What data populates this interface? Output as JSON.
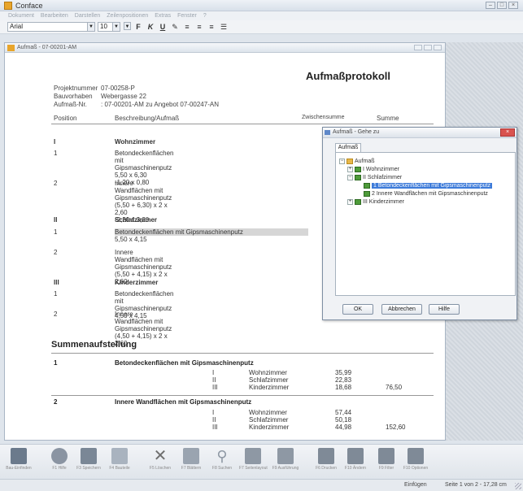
{
  "app": {
    "title": "Conface",
    "menu": [
      "Dokument",
      "Bearbeiten",
      "Darstellen",
      "Zeilenpositionen",
      "Extras",
      "Fenster",
      "?"
    ]
  },
  "format": {
    "font": "Arial",
    "size": "10"
  },
  "docwin": {
    "title": "Aufmaß - 07-00201-AM"
  },
  "doc": {
    "title": "Aufmaßprotokoll",
    "meta": [
      {
        "label": "Projektnummer",
        "value": "07-00258-P"
      },
      {
        "label": "Bauvorhaben",
        "value": "Webergasse 22"
      },
      {
        "label": "Aufmaß-Nr.",
        "value": ": 07-00201-AM zu Angebot 07-00247-AN"
      }
    ],
    "columns": {
      "position": "Position",
      "description": "Beschreibung/Aufmaß",
      "subtotal": "Zwischensumme",
      "total": "Summe"
    },
    "sections": [
      {
        "num": "I",
        "title": "Wohnzimmer",
        "items": [
          {
            "num": "1",
            "lines": [
              "Betondeckenflächen mit Gipsmaschinenputz",
              "5,50 x 6,30",
              "-1,20 x 0,80"
            ]
          },
          {
            "num": "2",
            "lines": [
              "Innere Wandflächen mit Gipsmaschinenputz",
              "(5,50 + 6,30) x 2 x 2,60",
              "-2,20 x 3,20"
            ]
          }
        ]
      },
      {
        "num": "II",
        "title": "Schlafzimmer",
        "items": [
          {
            "num": "1",
            "lines": [
              "Betondeckenflächen mit Gipsmaschinenputz",
              "5,50 x 4,15"
            ]
          },
          {
            "num": "2",
            "lines": [
              "Innere Wandflächen mit Gipsmaschinenputz",
              "(5,50 + 4,15) x 2 x 2,60"
            ]
          }
        ]
      },
      {
        "num": "III",
        "title": "Kinderzimmer",
        "items": [
          {
            "num": "1",
            "lines": [
              "Betondeckenflächen mit Gipsmaschinenputz",
              "4,50 x 4,15"
            ]
          },
          {
            "num": "2",
            "lines": [
              "Innere Wandflächen mit Gipsmaschinenputz",
              "(4,50 + 4,15) x 2 x 2,60"
            ]
          }
        ]
      }
    ],
    "summary": {
      "title": "Summenaufstellung",
      "groups": [
        {
          "num": "1",
          "title": "Betondeckenflächen mit Gipsmaschinenputz",
          "rows": [
            {
              "roman": "I",
              "room": "Wohnzimmer",
              "value": "35,99",
              "total": ""
            },
            {
              "roman": "II",
              "room": "Schlafzimmer",
              "value": "22,83",
              "total": ""
            },
            {
              "roman": "III",
              "room": "Kinderzimmer",
              "value": "18,68",
              "total": "76,50"
            }
          ]
        },
        {
          "num": "2",
          "title": "Innere Wandflächen mit Gipsmaschinenputz",
          "rows": [
            {
              "roman": "I",
              "room": "Wohnzimmer",
              "value": "57,44",
              "total": ""
            },
            {
              "roman": "II",
              "room": "Schlafzimmer",
              "value": "50,18",
              "total": ""
            },
            {
              "roman": "III",
              "room": "Kinderzimmer",
              "value": "44,98",
              "total": "152,60"
            }
          ]
        }
      ]
    }
  },
  "dialog": {
    "title": "Aufmaß - Gehe zu",
    "close": "×",
    "tab": "Aufmaß",
    "tree": [
      {
        "label": "Aufmaß",
        "exp": "−",
        "icon": "folder",
        "level": 0
      },
      {
        "label": "I  Wohnzimmer",
        "exp": "+",
        "icon": "green",
        "level": 1
      },
      {
        "label": "II  Schlafzimmer",
        "exp": "−",
        "icon": "green",
        "level": 1
      },
      {
        "label": "1  Betondeckenflächen mit Gipsmaschinenputz",
        "exp": "",
        "icon": "green",
        "level": 2,
        "selected": true
      },
      {
        "label": "2  Innere Wandflächen mit Gipsmaschinenputz",
        "exp": "",
        "icon": "green",
        "level": 2
      },
      {
        "label": "III  Kinderzimmer",
        "exp": "+",
        "icon": "green",
        "level": 1
      }
    ],
    "buttons": {
      "ok": "OK",
      "cancel": "Abbrechen",
      "help": "Hilfe"
    }
  },
  "toolbar": {
    "buttons": [
      {
        "label": "Bau-Einfinden",
        "icon": "open-icon",
        "color": "#6b7a8c"
      },
      {
        "label": "F1 Hilfe",
        "icon": "help-icon",
        "color": "#8a94a2"
      },
      {
        "label": "F3 Speichern",
        "icon": "save-icon",
        "color": "#7a8796"
      },
      {
        "label": "F4 Bauteile",
        "icon": "document-icon",
        "color": "#a9b3bf"
      },
      {
        "label": "F5 Löschen",
        "icon": "delete-icon",
        "color": "#6f6f6f"
      },
      {
        "label": "F7 Blättern",
        "icon": "page-icon",
        "color": "#9aa4b0"
      },
      {
        "label": "F8 Suchen",
        "icon": "search-icon",
        "color": "#8e98a4"
      },
      {
        "label": "F7 Seitenlayout",
        "icon": "layout-icon",
        "color": "#8e98a4"
      },
      {
        "label": "F9 Ausführung",
        "icon": "paste-icon",
        "color": "#8e98a4"
      },
      {
        "label": "F6 Drucken",
        "icon": "print-icon",
        "color": "#7f8a97"
      },
      {
        "label": "F10 Ändern",
        "icon": "tools-icon",
        "color": "#7f8a97"
      },
      {
        "label": "F9 Filter",
        "icon": "filter-icon",
        "color": "#7f8a97"
      },
      {
        "label": "F10 Optionen",
        "icon": "options-icon",
        "color": "#7f8a97"
      }
    ]
  },
  "status": {
    "mode": "Einfügen",
    "page": "Seite 1 von 2 - 17,28 cm"
  }
}
